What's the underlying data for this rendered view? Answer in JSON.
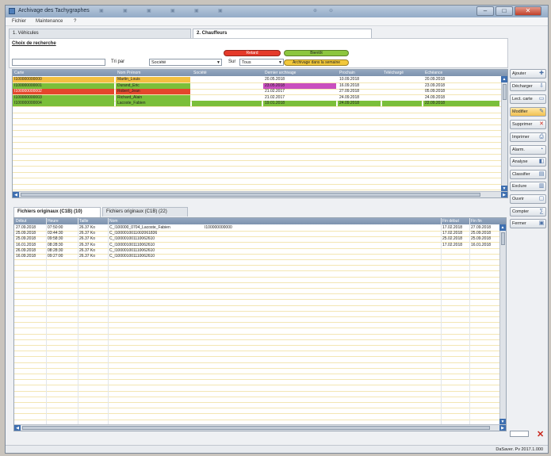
{
  "window": {
    "title": "Archivage des Tachygraphes"
  },
  "menu": [
    "Fichier",
    "Maintenance",
    "?"
  ],
  "tabs": [
    {
      "label": "1. Véhicules",
      "active": false
    },
    {
      "label": "2. Chauffeurs",
      "active": true
    }
  ],
  "filter": {
    "heading": "Choix de recherche",
    "sort_label": "Tri par",
    "sort_value": "Société",
    "scope_label": "Sur",
    "scope_value": "Tous",
    "status_pills": [
      {
        "label": "Retard",
        "color": "#e53a2a"
      },
      {
        "label": "Bientôt",
        "color": "#8cc63e"
      },
      {
        "label": "Archivage dans la semaine",
        "color": "#f2c83b"
      }
    ]
  },
  "driver_grid": {
    "headers": [
      "Carte",
      "Nom Prénom",
      "Société",
      "Dernier archivage",
      "Prochain",
      "Téléchargé",
      "Echéance"
    ],
    "rows": [
      {
        "color": "#f2c040",
        "cells": [
          "I100000000000",
          "Martin_Louis",
          "",
          "20.05.2018",
          "10.09.2018",
          "",
          "20.09.2018"
        ]
      },
      {
        "color": "#7bbf3a",
        "cells": [
          "I100000000001",
          "Durand_Eric",
          "",
          "23.05.2018",
          "16.09.2018",
          "",
          "23.09.2018"
        ]
      },
      {
        "color": "#e4472c",
        "cells": [
          "I100000000002",
          "Robert_Jean",
          "",
          "21.02.2017",
          "27.09.2018",
          "",
          "05.09.2018"
        ]
      },
      {
        "color": "#7bbf3a",
        "cells": [
          "I100000000003",
          "Richard_Alain",
          "",
          "21.02.2017",
          "24.09.2018",
          "",
          "24.09.2018"
        ]
      },
      {
        "color": "#7bbf3a",
        "cells": [
          "I100000000004",
          "Lacoste_Fabien",
          "",
          "19.01.2018",
          "24.09.2018",
          "",
          "22.09.2018"
        ]
      }
    ]
  },
  "bottom_tabs": [
    {
      "label": "Fichiers originaux (C1B) (10)",
      "active": true
    },
    {
      "label": "Fichiers originaux (C1B) (22)",
      "active": false
    }
  ],
  "files_grid": {
    "headers": [
      "Début",
      "Heure",
      "Taille",
      "Nom",
      "",
      "Fin début",
      "Fin fin"
    ],
    "rows": [
      [
        "27.09.2018",
        "07:50:00",
        "26.37 Ko",
        "C_I100000_0704_Lacoste_Fabien",
        "I100000000000",
        "17.02.2018",
        "27.09.2018"
      ],
      [
        "25.09.2018",
        "03:44:30",
        "26.37 Ko",
        "C_I1000010011002061836",
        "",
        "17.02.2018",
        "25.09.2018"
      ],
      [
        "25.09.2018",
        "09:58:30",
        "26.37 Ko",
        "C_I100001001110062610",
        "",
        "25.02.2018",
        "25.09.2018"
      ],
      [
        "16.01.2018",
        "08:28:30",
        "26.37 Ko",
        "C_I100001001110062610",
        "",
        "17.02.2018",
        "16.01.2018"
      ],
      [
        "26.09.2018",
        "08:28:30",
        "26.37 Ko",
        "C_I100001001110062610",
        "",
        "",
        ""
      ],
      [
        "16.09.2018",
        "09:27:00",
        "26.37 Ko",
        "C_I100001001110062610",
        "",
        "",
        ""
      ]
    ]
  },
  "sidebar_buttons": [
    {
      "label": "Ajouter",
      "icon": "add-icon"
    },
    {
      "label": "Décharger",
      "icon": "download-icon"
    },
    {
      "label": "Lect. carte",
      "icon": "card-icon"
    },
    {
      "label": "Modifier",
      "icon": "edit-icon"
    },
    {
      "label": "Supprimer",
      "icon": "delete-icon"
    },
    {
      "label": "Imprimer",
      "icon": "print-icon"
    },
    {
      "label": "Alarm.",
      "icon": "alarm-icon"
    },
    {
      "label": "Analyse",
      "icon": "analyse-icon"
    },
    {
      "label": "Classifier",
      "icon": "classify-icon"
    },
    {
      "label": "Exclure",
      "icon": "exclude-icon"
    },
    {
      "label": "Ouvrir",
      "icon": "open-icon"
    },
    {
      "label": "Compter",
      "icon": "count-icon"
    },
    {
      "label": "Fermer",
      "icon": "close-icon"
    }
  ],
  "status": {
    "right": "DaSaver. Pv 2017.1.000"
  }
}
